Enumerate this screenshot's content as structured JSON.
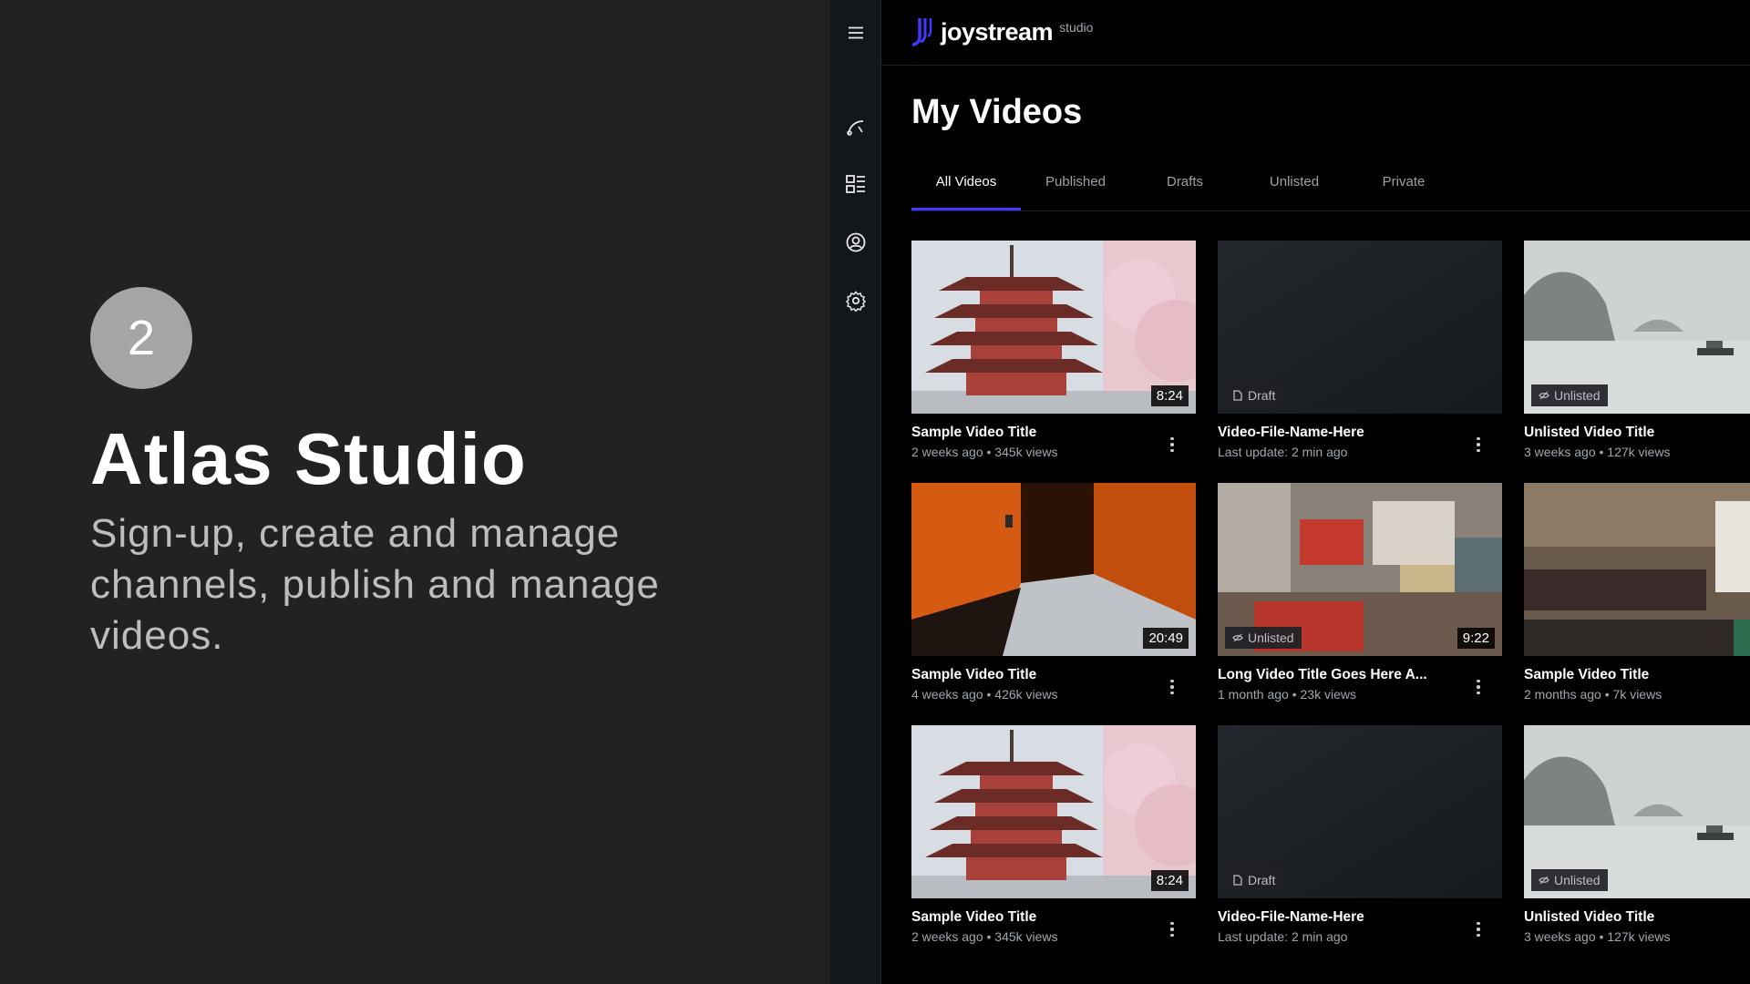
{
  "promo": {
    "step": "2",
    "title": "Atlas Studio",
    "description": "Sign-up, create and manage channels, publish and manage videos."
  },
  "rail": {
    "icons": [
      "hamburger-menu-icon",
      "upload-icon",
      "videos-grid-icon",
      "channel-icon",
      "settings-gear-icon"
    ]
  },
  "header": {
    "logo_text": "joystream",
    "logo_sub": "studio",
    "accent": "#4038ff"
  },
  "page": {
    "title": "My Videos"
  },
  "tabs": [
    {
      "label": "All Videos",
      "active": true
    },
    {
      "label": "Published",
      "active": false
    },
    {
      "label": "Drafts",
      "active": false
    },
    {
      "label": "Unlisted",
      "active": false
    },
    {
      "label": "Private",
      "active": false
    }
  ],
  "videos": [
    {
      "title": "Sample Video Title",
      "meta": "2 weeks ago • 345k views",
      "duration": "8:24",
      "badge": "",
      "thumb": "pagoda"
    },
    {
      "title": "Video-File-Name-Here",
      "meta": "Last update: 2 min ago",
      "duration": "",
      "badge": "Draft",
      "thumb": "blank"
    },
    {
      "title": "Unlisted Video Title",
      "meta": "3 weeks ago • 127k views",
      "duration": "",
      "badge": "Unlisted",
      "thumb": "lake"
    },
    {
      "title": "Sample Video Title",
      "meta": "4 weeks ago • 426k views",
      "duration": "20:49",
      "badge": "",
      "thumb": "torii"
    },
    {
      "title": "Long Video Title Goes Here A...",
      "meta": "1 month ago • 23k views",
      "duration": "9:22",
      "badge": "Unlisted",
      "thumb": "street"
    },
    {
      "title": "Sample Video Title",
      "meta": "2 months ago • 7k views",
      "duration": "",
      "badge": "",
      "thumb": "signs"
    },
    {
      "title": "Sample Video Title",
      "meta": "2 weeks ago • 345k views",
      "duration": "8:24",
      "badge": "",
      "thumb": "pagoda"
    },
    {
      "title": "Video-File-Name-Here",
      "meta": "Last update: 2 min ago",
      "duration": "",
      "badge": "Draft",
      "thumb": "blank"
    },
    {
      "title": "Unlisted Video Title",
      "meta": "3 weeks ago • 127k views",
      "duration": "",
      "badge": "Unlisted",
      "thumb": "lake"
    }
  ]
}
